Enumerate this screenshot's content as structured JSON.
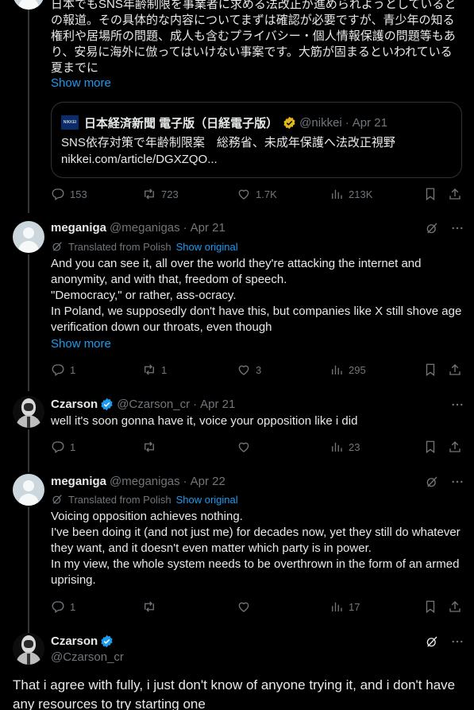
{
  "thread": {
    "top_post": {
      "text": "日本でもSNS年齢制限を事業者に求める法改正が進められようとしているとの報道。その具体的な内容についてまずは確認が必要ですが、青少年の知る権利や居場所の問題、成人も含むプライバシー・個人情報保護の問題等もあり、安易に海外に倣ってはいけない事案です。大筋が固まるといわれている夏までに",
      "show_more": "Show more",
      "quote": {
        "name": "日本経済新聞 電子版（日経電子版）",
        "handle": "@nikkei",
        "date": "Apr 21",
        "logo_text": "NIKKEI",
        "text": "SNS依存対策で年齢制限案　総務省、未成年保護へ法改正視野",
        "link": "nikkei.com/article/DGXZQO..."
      },
      "replies": "153",
      "reposts": "723",
      "likes": "1.7K",
      "views": "213K"
    },
    "reply1": {
      "name": "meganiga",
      "handle": "@meganigas",
      "date": "Apr 21",
      "translated_label": "Translated from Polish",
      "show_original": "Show original",
      "text": "And you can see it, all over the world they're attacking the internet and anonymity, and with that, freedom of speech.\n\"Democracy,\" or rather, ass-ocracy.\nIn Poland, we supposedly don't have this, but companies like X still shove age verification down our throats, even though",
      "show_more": "Show more",
      "replies": "1",
      "reposts": "1",
      "likes": "3",
      "views": "295"
    },
    "reply2": {
      "name": "Czarson",
      "handle": "@Czarson_cr",
      "date": "Apr 21",
      "text": "well it's soon gonna have it, voice your opposition like i did",
      "replies": "1",
      "views": "23"
    },
    "reply3": {
      "name": "meganiga",
      "handle": "@meganigas",
      "date": "Apr 22",
      "translated_label": "Translated from Polish",
      "show_original": "Show original",
      "text": "Voicing opposition achieves nothing.\nI've been doing it (and not just me) for decades now, yet they still do whatever they want, and it doesn't even matter which party is in power.\nIn my view, the whole system needs to be overthrown in the form of an armed uprising.",
      "replies": "1",
      "views": "17"
    },
    "focused": {
      "name": "Czarson",
      "handle": "@Czarson_cr",
      "text": "That i agree with fully, i just don't know of anyone trying it, and i don't have any resources to try starting one"
    }
  },
  "colors": {
    "background": "#000000",
    "text": "#e7e9ea",
    "muted": "#71767b",
    "link": "#1d9bf0",
    "verified": "#1d9bf0",
    "gold_badge": "#e2b719",
    "border": "#2f3336"
  },
  "icons": [
    "reply-icon",
    "repost-icon",
    "like-icon",
    "views-icon",
    "bookmark-icon",
    "share-icon",
    "grok-icon",
    "more-icon",
    "translate-icon",
    "verified-icon"
  ]
}
